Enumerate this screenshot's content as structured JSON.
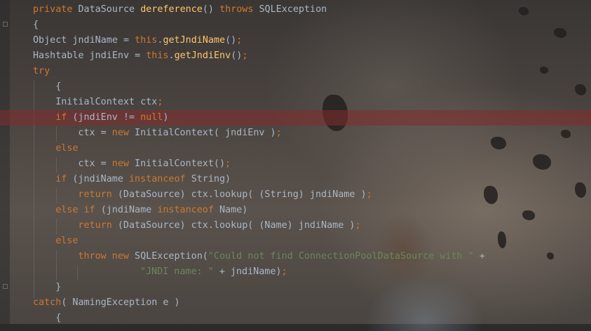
{
  "editor": {
    "colors": {
      "keyword": "#cc7832",
      "identifier": "#a9b7c6",
      "method": "#ffc66d",
      "string": "#6a8759",
      "breakpoint_line": "#842c2c"
    },
    "highlighted_line_index": 7,
    "lines": [
      {
        "indent": 2,
        "tokens": [
          [
            "kw",
            "private "
          ],
          [
            "plain",
            "DataSource "
          ],
          [
            "method",
            "dereference"
          ],
          [
            "plain",
            "() "
          ],
          [
            "kw",
            "throws "
          ],
          [
            "plain",
            "SQLException"
          ]
        ]
      },
      {
        "indent": 2,
        "tokens": [
          [
            "plain",
            "{"
          ]
        ]
      },
      {
        "indent": 2,
        "tokens": [
          [
            "plain",
            "Object jndiName = "
          ],
          [
            "kw",
            "this"
          ],
          [
            "plain",
            "."
          ],
          [
            "method",
            "getJndiName"
          ],
          [
            "plain",
            "()"
          ],
          [
            "punct",
            ";"
          ]
        ]
      },
      {
        "indent": 2,
        "tokens": [
          [
            "plain",
            "Hashtable jndiEnv = "
          ],
          [
            "kw",
            "this"
          ],
          [
            "plain",
            "."
          ],
          [
            "method",
            "getJndiEnv"
          ],
          [
            "plain",
            "()"
          ],
          [
            "punct",
            ";"
          ]
        ]
      },
      {
        "indent": 2,
        "tokens": [
          [
            "kw",
            "try"
          ]
        ]
      },
      {
        "indent": 6,
        "tokens": [
          [
            "plain",
            "{"
          ]
        ]
      },
      {
        "indent": 6,
        "tokens": [
          [
            "plain",
            "InitialContext ctx"
          ],
          [
            "punct",
            ";"
          ]
        ]
      },
      {
        "indent": 6,
        "tokens": [
          [
            "kw",
            "if "
          ],
          [
            "plain",
            "(jndiEnv != "
          ],
          [
            "kw",
            "null"
          ],
          [
            "plain",
            ")"
          ]
        ]
      },
      {
        "indent": 10,
        "tokens": [
          [
            "plain",
            "ctx = "
          ],
          [
            "kw",
            "new "
          ],
          [
            "plain",
            "InitialContext( jndiEnv )"
          ],
          [
            "punct",
            ";"
          ]
        ]
      },
      {
        "indent": 6,
        "tokens": [
          [
            "kw",
            "else"
          ]
        ]
      },
      {
        "indent": 10,
        "tokens": [
          [
            "plain",
            "ctx = "
          ],
          [
            "kw",
            "new "
          ],
          [
            "plain",
            "InitialContext()"
          ],
          [
            "punct",
            ";"
          ]
        ]
      },
      {
        "indent": 6,
        "tokens": [
          [
            "kw",
            "if "
          ],
          [
            "plain",
            "(jndiName "
          ],
          [
            "kw",
            "instanceof "
          ],
          [
            "plain",
            "String)"
          ]
        ]
      },
      {
        "indent": 10,
        "tokens": [
          [
            "kw",
            "return "
          ],
          [
            "plain",
            "(DataSource) ctx.lookup( (String) jndiName )"
          ],
          [
            "punct",
            ";"
          ]
        ]
      },
      {
        "indent": 6,
        "tokens": [
          [
            "kw",
            "else if "
          ],
          [
            "plain",
            "(jndiName "
          ],
          [
            "kw",
            "instanceof "
          ],
          [
            "plain",
            "Name)"
          ]
        ]
      },
      {
        "indent": 10,
        "tokens": [
          [
            "kw",
            "return "
          ],
          [
            "plain",
            "(DataSource) ctx.lookup( (Name) jndiName )"
          ],
          [
            "punct",
            ";"
          ]
        ]
      },
      {
        "indent": 6,
        "tokens": [
          [
            "kw",
            "else"
          ]
        ]
      },
      {
        "indent": 10,
        "tokens": [
          [
            "kw",
            "throw new "
          ],
          [
            "plain",
            "SQLException("
          ],
          [
            "str",
            "\"Could not find ConnectionPoolDataSource with \" "
          ],
          [
            "plain",
            "+"
          ]
        ]
      },
      {
        "indent": 21,
        "tokens": [
          [
            "str",
            "\"JNDI name: \" "
          ],
          [
            "plain",
            "+ jndiName)"
          ],
          [
            "punct",
            ";"
          ]
        ]
      },
      {
        "indent": 6,
        "tokens": [
          [
            "plain",
            "}"
          ]
        ]
      },
      {
        "indent": 2,
        "tokens": [
          [
            "kw",
            "catch"
          ],
          [
            "plain",
            "( NamingException e )"
          ]
        ]
      },
      {
        "indent": 6,
        "tokens": [
          [
            "plain",
            "{"
          ]
        ]
      }
    ]
  }
}
